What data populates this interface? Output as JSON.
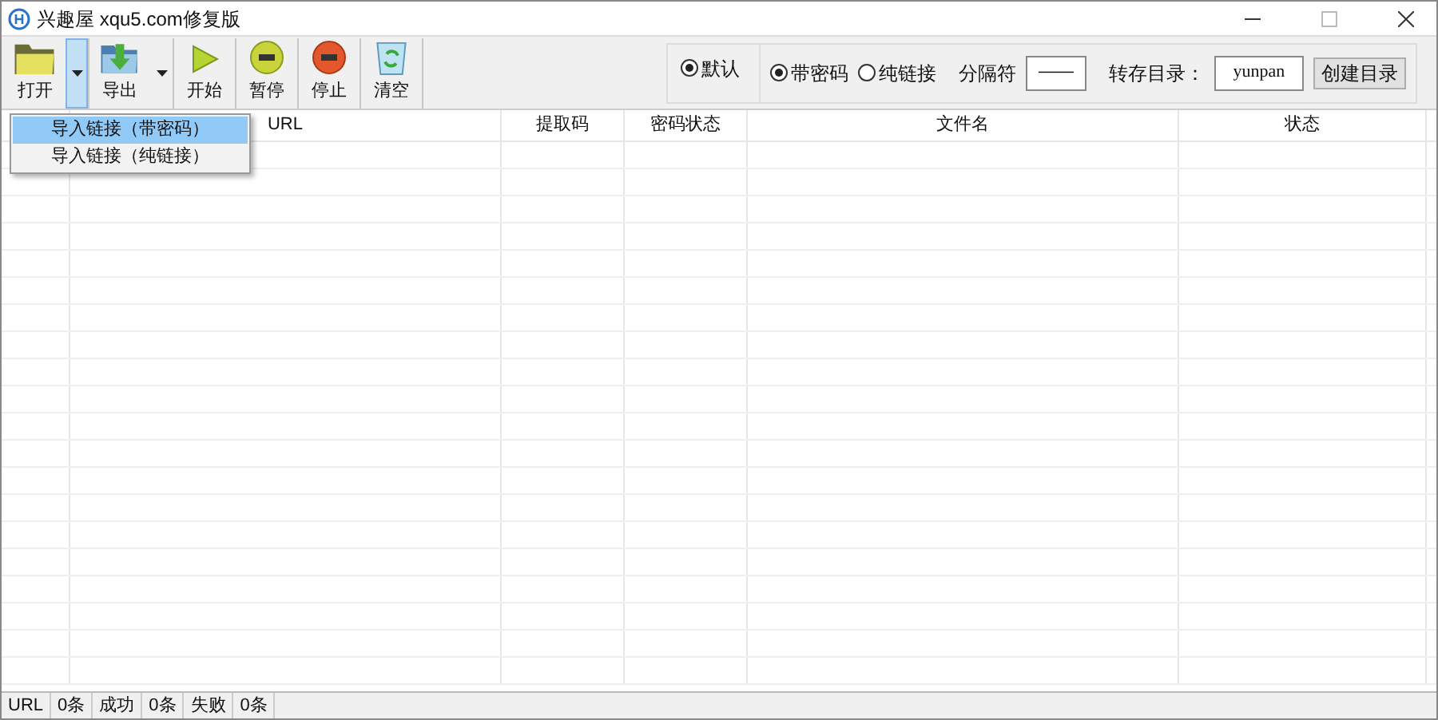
{
  "window": {
    "title": "兴趣屋 xqu5.com修复版"
  },
  "toolbar": [
    {
      "label": "打开",
      "kind": "open",
      "dropdown": true,
      "menu_open": true
    },
    {
      "label": "导出",
      "kind": "export",
      "dropdown": true,
      "menu_open": false
    },
    {
      "label": "开始",
      "kind": "start"
    },
    {
      "label": "暂停",
      "kind": "pause"
    },
    {
      "label": "停止",
      "kind": "stop"
    },
    {
      "label": "清空",
      "kind": "clear"
    }
  ],
  "menu": [
    {
      "label": "导入链接（带密码）",
      "selected": true
    },
    {
      "label": "导入链接（纯链接）",
      "selected": false
    }
  ],
  "options": {
    "mode": [
      {
        "label": "默认",
        "selected": true
      }
    ],
    "link_type": [
      {
        "label": "带密码",
        "selected": true
      },
      {
        "label": "纯链接",
        "selected": false
      }
    ],
    "separator_label": "分隔符",
    "separator": "——",
    "folder_label": "转存目录：",
    "folder": "yunpan",
    "create_button": "创建目录"
  },
  "table": {
    "columns": [
      "URL",
      "提取码",
      "密码状态",
      "文件名",
      "状态"
    ]
  },
  "status_bar": [
    "URL",
    "0条",
    "成功",
    "0条",
    "失败",
    "0条"
  ]
}
